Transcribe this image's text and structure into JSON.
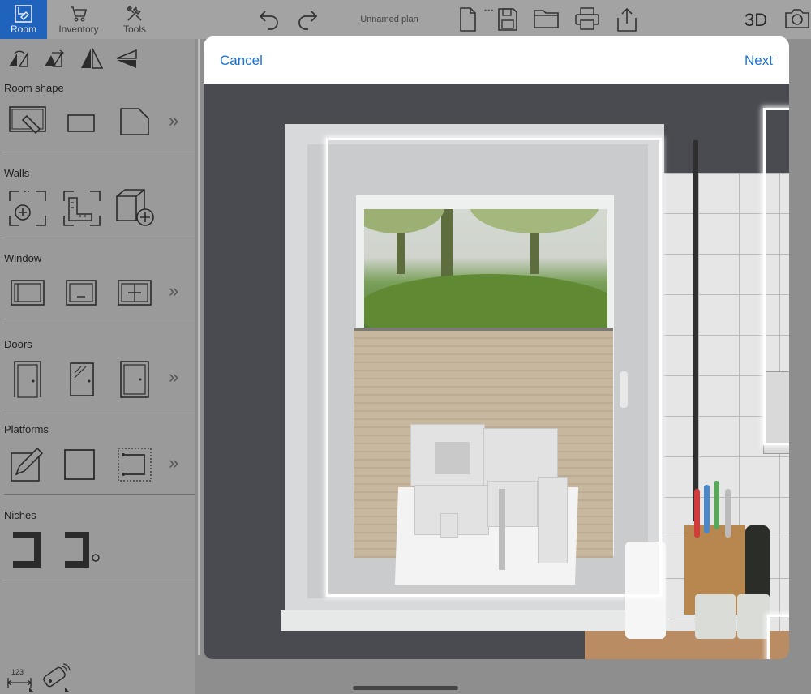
{
  "toolbar": {
    "tabs": [
      {
        "label": "Room",
        "icon": "room-plan-icon",
        "active": true
      },
      {
        "label": "Inventory",
        "icon": "cart-icon",
        "active": false
      },
      {
        "label": "Tools",
        "icon": "tools-icon",
        "active": false
      }
    ],
    "plan_name": "Unnamed plan",
    "view_mode": "3D",
    "icons": [
      "undo-icon",
      "redo-icon",
      "new-file-icon",
      "save-icon",
      "folder-icon",
      "print-icon",
      "share-icon",
      "camera-icon"
    ],
    "accent_color": "#1f63bd"
  },
  "sidebar": {
    "transform_icons": [
      "rotate-icon",
      "mirror-horizontal-icon",
      "mirror-vertical-icon",
      "flip-icon"
    ],
    "sections": [
      {
        "title": "Room shape",
        "items": [
          "draw-room-icon",
          "rectangle-room-icon",
          "l-room-icon"
        ],
        "has_more": true
      },
      {
        "title": "Walls",
        "items": [
          "add-wall-icon",
          "measure-wall-icon",
          "add-box-icon"
        ],
        "has_more": false
      },
      {
        "title": "Window",
        "items": [
          "window-single-icon",
          "window-lower-icon",
          "window-cross-icon"
        ],
        "has_more": true
      },
      {
        "title": "Doors",
        "items": [
          "door-icon",
          "glass-door-icon",
          "door-frame-icon"
        ],
        "has_more": true
      },
      {
        "title": "Platforms",
        "items": [
          "draw-platform-icon",
          "square-platform-icon",
          "dotted-platform-icon"
        ],
        "has_more": true
      },
      {
        "title": "Niches",
        "items": [
          "niche-icon",
          "niche-round-icon"
        ],
        "has_more": false
      }
    ],
    "bottom_icons": [
      "dimension-123-icon",
      "remote-icon"
    ],
    "bottom_label": "123"
  },
  "modal": {
    "cancel_label": "Cancel",
    "next_label": "Next",
    "link_color": "#1a73d8"
  }
}
